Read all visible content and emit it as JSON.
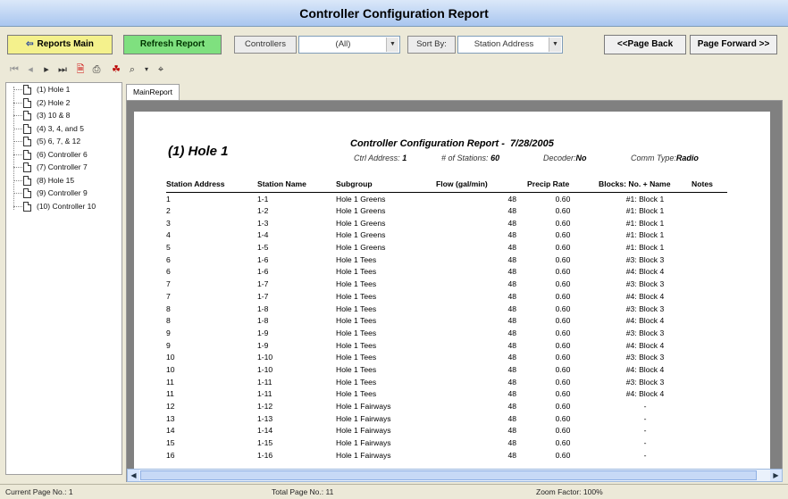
{
  "window": {
    "title": "Controller Configuration Report"
  },
  "toolbar": {
    "reports_main": "Reports Main",
    "refresh_report": "Refresh Report",
    "controllers_label": "Controllers",
    "controllers_value": "(All)",
    "sort_by_label": "Sort By:",
    "sort_by_value": "Station Address",
    "page_back": "<<Page Back",
    "page_forward": "Page Forward >>"
  },
  "tree": {
    "items": [
      "(1) Hole 1",
      "(2) Hole 2",
      "(3) 10 & 8",
      "(4) 3, 4, and 5",
      "(5) 6, 7, & 12",
      "(6) Controller 6",
      "(7) Controller 7",
      "(8) Hole 15",
      "(9) Controller 9",
      "(10) Controller 10"
    ]
  },
  "tab": {
    "label": "MainReport"
  },
  "report": {
    "section_title": "(1) Hole 1",
    "header_title": "Controller Configuration Report -",
    "header_date": "7/28/2005",
    "ctrl_address_label": "Ctrl Address:",
    "ctrl_address_value": "1",
    "stations_label": "# of Stations:",
    "stations_value": "60",
    "decoder_label": "Decoder:",
    "decoder_value": "No",
    "comm_label": "Comm Type:",
    "comm_value": "Radio",
    "columns": [
      "Station Address",
      "Station Name",
      "Subgroup",
      "Flow (gal/min)",
      "Precip Rate",
      "Blocks: No. + Name",
      "Notes"
    ],
    "rows": [
      [
        "1",
        "1-1",
        "Hole 1 Greens",
        "48",
        "0.60",
        "#1: Block 1",
        ""
      ],
      [
        "2",
        "1-2",
        "Hole 1 Greens",
        "48",
        "0.60",
        "#1: Block 1",
        ""
      ],
      [
        "3",
        "1-3",
        "Hole 1 Greens",
        "48",
        "0.60",
        "#1: Block 1",
        ""
      ],
      [
        "4",
        "1-4",
        "Hole 1 Greens",
        "48",
        "0.60",
        "#1: Block 1",
        ""
      ],
      [
        "5",
        "1-5",
        "Hole 1 Greens",
        "48",
        "0.60",
        "#1: Block 1",
        ""
      ],
      [
        "6",
        "1-6",
        "Hole 1 Tees",
        "48",
        "0.60",
        "#3: Block 3",
        ""
      ],
      [
        "6",
        "1-6",
        "Hole 1 Tees",
        "48",
        "0.60",
        "#4: Block 4",
        ""
      ],
      [
        "7",
        "1-7",
        "Hole 1 Tees",
        "48",
        "0.60",
        "#3: Block 3",
        ""
      ],
      [
        "7",
        "1-7",
        "Hole 1 Tees",
        "48",
        "0.60",
        "#4: Block 4",
        ""
      ],
      [
        "8",
        "1-8",
        "Hole 1 Tees",
        "48",
        "0.60",
        "#3: Block 3",
        ""
      ],
      [
        "8",
        "1-8",
        "Hole 1 Tees",
        "48",
        "0.60",
        "#4: Block 4",
        ""
      ],
      [
        "9",
        "1-9",
        "Hole 1 Tees",
        "48",
        "0.60",
        "#3: Block 3",
        ""
      ],
      [
        "9",
        "1-9",
        "Hole 1 Tees",
        "48",
        "0.60",
        "#4: Block 4",
        ""
      ],
      [
        "10",
        "1-10",
        "Hole 1 Tees",
        "48",
        "0.60",
        "#3: Block 3",
        ""
      ],
      [
        "10",
        "1-10",
        "Hole 1 Tees",
        "48",
        "0.60",
        "#4: Block 4",
        ""
      ],
      [
        "11",
        "1-11",
        "Hole 1 Tees",
        "48",
        "0.60",
        "#3: Block 3",
        ""
      ],
      [
        "11",
        "1-11",
        "Hole 1 Tees",
        "48",
        "0.60",
        "#4: Block 4",
        ""
      ],
      [
        "12",
        "1-12",
        "Hole 1 Fairways",
        "48",
        "0.60",
        "-",
        ""
      ],
      [
        "13",
        "1-13",
        "Hole 1 Fairways",
        "48",
        "0.60",
        "-",
        ""
      ],
      [
        "14",
        "1-14",
        "Hole 1 Fairways",
        "48",
        "0.60",
        "-",
        ""
      ],
      [
        "15",
        "1-15",
        "Hole 1 Fairways",
        "48",
        "0.60",
        "-",
        ""
      ],
      [
        "16",
        "1-16",
        "Hole 1 Fairways",
        "48",
        "0.60",
        "-",
        ""
      ]
    ]
  },
  "status": {
    "current_page": "Current Page No.: 1",
    "total_page": "Total Page No.: 11",
    "zoom": "Zoom Factor: 100%"
  },
  "colors": {
    "reports_main_bg": "#f4f18c",
    "refresh_bg": "#7fe07f",
    "title_gradient_top": "#dbe8f9",
    "title_gradient_bottom": "#a9c6ef"
  },
  "icons": [
    "first-page-icon",
    "prev-page-icon",
    "next-page-icon",
    "last-page-icon",
    "export-icon",
    "print-icon",
    "acrobat-icon",
    "zoom-icon",
    "find-icon"
  ]
}
